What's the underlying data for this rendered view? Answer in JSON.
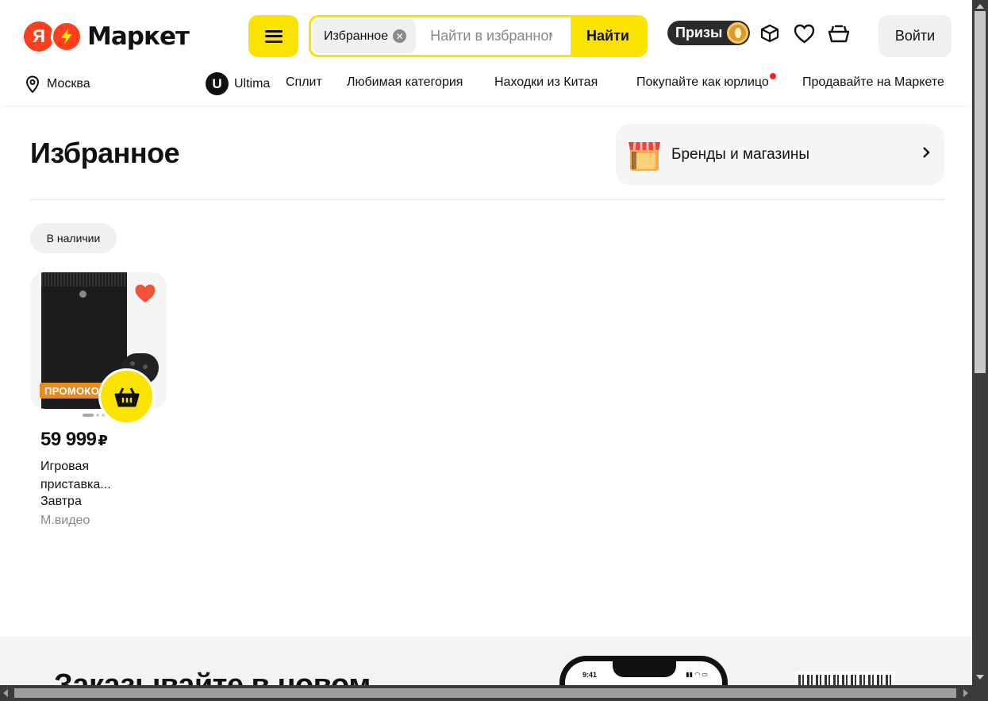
{
  "header": {
    "logo_ya": "Я",
    "logo_text": "Маркет",
    "catalog_icon": "menu-icon",
    "search": {
      "chip_label": "Избранное",
      "placeholder": "Найти в избранном",
      "button_label": "Найти"
    },
    "prizes_label": "Призы",
    "login_label": "Войти",
    "location": "Москва",
    "nav": {
      "ultima_badge": "U",
      "ultima": "Ultima",
      "split": "Сплит",
      "favorite_category": "Любимая категория",
      "china": "Находки из Китая",
      "legal": "Покупайте как юрлицо",
      "sell": "Продавайте на Маркете"
    }
  },
  "main": {
    "title": "Избранное",
    "brands_label": "Бренды и магазины",
    "filter_chip": "В наличии",
    "products": [
      {
        "price": "59 999",
        "currency": "₽",
        "name": "Игровая приставка...",
        "delivery": "Завтра",
        "seller": "М.видео",
        "badge": "ПРОМОКОД",
        "favorite": true
      }
    ]
  },
  "footer": {
    "title": "Заказывайте в новом",
    "phone_time": "9:41"
  },
  "colors": {
    "brand_yellow": "#fbe300",
    "brand_red": "#fc3f1d",
    "promo_orange": "#e98a1c",
    "heart_red": "#f5523a"
  }
}
